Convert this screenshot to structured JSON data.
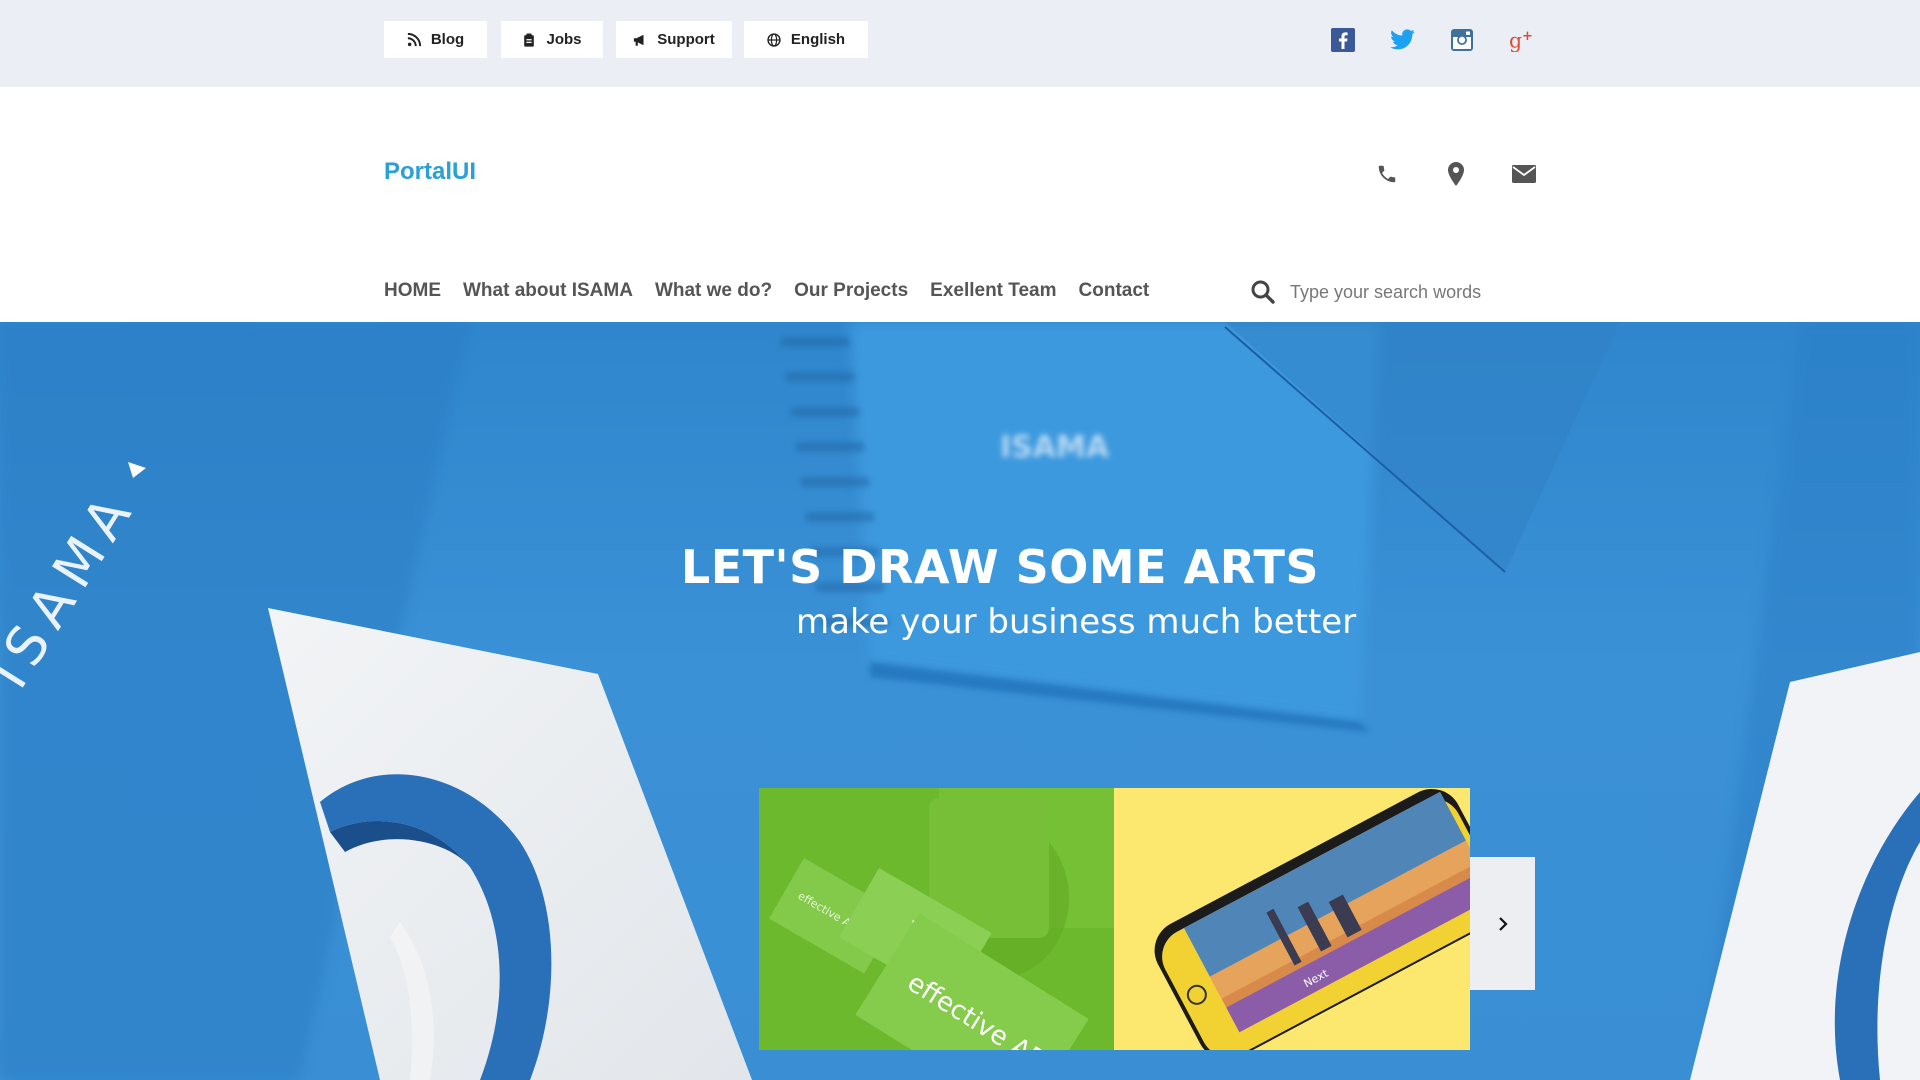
{
  "topbar": {
    "links": [
      {
        "label": "Blog",
        "icon": "rss-icon"
      },
      {
        "label": "Jobs",
        "icon": "clipboard-icon"
      },
      {
        "label": "Support",
        "icon": "megaphone-icon"
      },
      {
        "label": "English",
        "icon": "globe-icon"
      }
    ],
    "social": [
      "facebook-icon",
      "twitter-icon",
      "instagram-icon",
      "google-plus-icon"
    ]
  },
  "header": {
    "logo": "PortalUI",
    "contact_icons": [
      "phone-icon",
      "map-pin-icon",
      "envelope-icon"
    ]
  },
  "nav": {
    "items": [
      "HOME",
      "What about ISAMA",
      "What we do?",
      "Our Projects",
      "Exellent Team",
      "Contact"
    ]
  },
  "search": {
    "placeholder": "Type your search words",
    "value": ""
  },
  "hero": {
    "title": "LET'S DRAW SOME ARTS",
    "subtitle": "make your business much better",
    "brand_text": "ISAMA",
    "card1_text": "effective ART",
    "card1_small": "effective ART",
    "phone_text": "Next"
  },
  "colors": {
    "accent": "#2a9fd8",
    "topbar_bg": "#ebeef5",
    "hero_blue": "#3a8fd4",
    "facebook": "#3b5998",
    "twitter": "#1da1f2",
    "instagram": "#3f729b",
    "google_plus": "#dd4b39"
  }
}
